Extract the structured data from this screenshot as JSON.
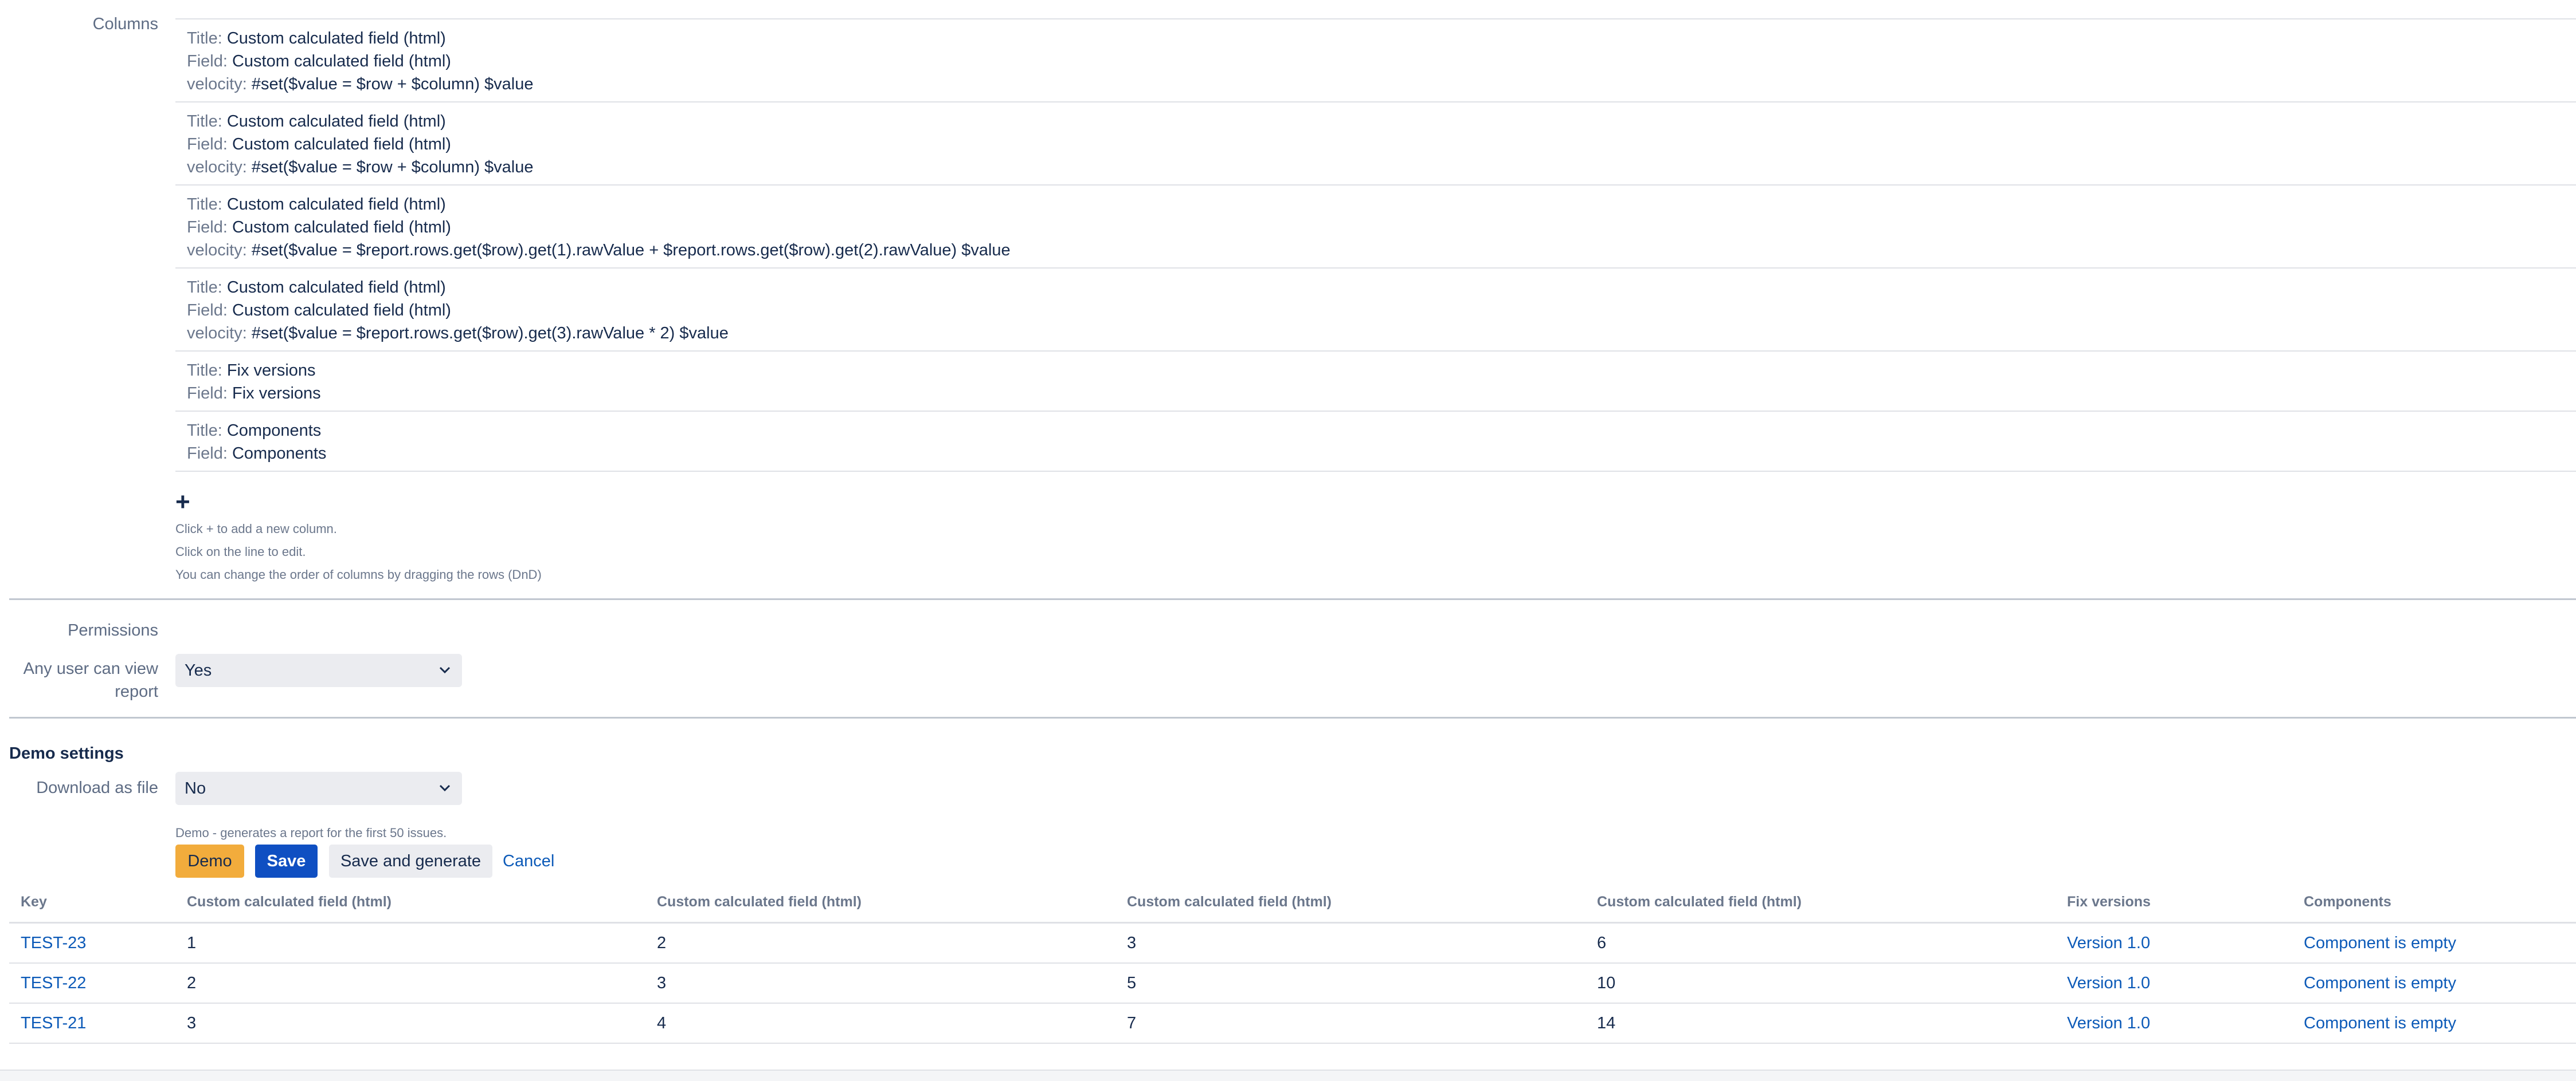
{
  "columns_section": {
    "label": "Columns",
    "items": [
      {
        "title_key": "Title:",
        "title": "Custom calculated field (html)",
        "field_key": "Field:",
        "field": "Custom calculated field (html)",
        "velocity_key": "velocity:",
        "velocity": "#set($value = $row + $column) $value"
      },
      {
        "title_key": "Title:",
        "title": "Custom calculated field (html)",
        "field_key": "Field:",
        "field": "Custom calculated field (html)",
        "velocity_key": "velocity:",
        "velocity": "#set($value = $row + $column) $value"
      },
      {
        "title_key": "Title:",
        "title": "Custom calculated field (html)",
        "field_key": "Field:",
        "field": "Custom calculated field (html)",
        "velocity_key": "velocity:",
        "velocity": "#set($value = $report.rows.get($row).get(1).rawValue + $report.rows.get($row).get(2).rawValue) $value"
      },
      {
        "title_key": "Title:",
        "title": "Custom calculated field (html)",
        "field_key": "Field:",
        "field": "Custom calculated field (html)",
        "velocity_key": "velocity:",
        "velocity": "#set($value = $report.rows.get($row).get(3).rawValue * 2) $value"
      },
      {
        "title_key": "Title:",
        "title": "Fix versions",
        "field_key": "Field:",
        "field": "Fix versions"
      },
      {
        "title_key": "Title:",
        "title": "Components",
        "field_key": "Field:",
        "field": "Components"
      }
    ],
    "add_symbol": "+",
    "hints": [
      "Click + to add a new column.",
      "Click on the line to edit.",
      "You can change the order of columns by dragging the rows (DnD)"
    ]
  },
  "permissions": {
    "label": "Permissions",
    "any_user_label": "Any user can view report",
    "any_user_value": "Yes"
  },
  "demo_settings": {
    "title": "Demo settings",
    "download_label": "Download as file",
    "download_value": "No",
    "note": "Demo - generates a report for the first 50 issues."
  },
  "buttons": {
    "demo": "Demo",
    "save": "Save",
    "save_generate": "Save and generate",
    "cancel": "Cancel"
  },
  "results": {
    "headers": [
      "Key",
      "Custom calculated field (html)",
      "Custom calculated field (html)",
      "Custom calculated field (html)",
      "Custom calculated field (html)",
      "Fix versions",
      "Components"
    ],
    "rows": [
      [
        "TEST-23",
        "1",
        "2",
        "3",
        "6",
        "Version 1.0",
        "Component is empty"
      ],
      [
        "TEST-22",
        "2",
        "3",
        "5",
        "10",
        "Version 1.0",
        "Component is empty"
      ],
      [
        "TEST-21",
        "3",
        "4",
        "7",
        "14",
        "Version 1.0",
        "Component is empty"
      ]
    ]
  },
  "colors": {
    "link": "#0c5ab8",
    "primary": "#0f4fc2",
    "demo": "#f2ac3c",
    "select_bg": "#ebecf0"
  },
  "icons": {
    "select_arrow": "chevron-down-icon",
    "add": "plus-icon"
  }
}
